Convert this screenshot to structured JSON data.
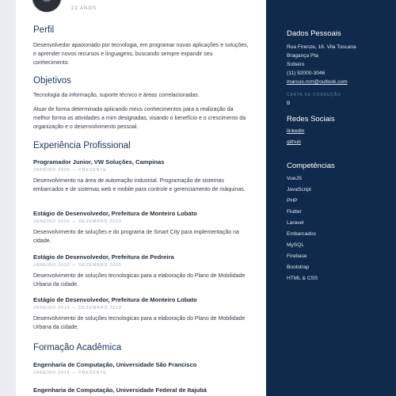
{
  "header": {
    "age": "22 ANOS"
  },
  "perfil": {
    "title": "Perfil",
    "text": "Desenvolvedor apaixonado por tecnologia, em programar novas aplicações e soluções, e aprender novos recursos e linguagens, buscando sempre expandir seu conhecimento."
  },
  "objetivos": {
    "title": "Objetivos",
    "line1": "Tecnologia da informação, suporte técnico e áreas correlacionadas.",
    "text": "Atuar de forma determinada aplicando meus conhecimentos para a realização da melhor forma as atividades a mim designadas, visando o benefício e o crescimento da organização e o desenvolvimento pessoal."
  },
  "experiencia": {
    "title": "Experiência Profissional",
    "jobs": [
      {
        "title": "Programador Junior, VW Soluções, Campinas",
        "date": "JANEIRO 2020 — PRESENTE",
        "desc": "Desenvolvimento na área de automação industrial. Programação de sistemas embarcados e de sistemas web e mobile para controle e gerenciamento de máquinas."
      },
      {
        "title": "Estágio de Desenvolvedor, Prefeitura de Monteiro Lobato",
        "date": "JANEIRO 2020 — DEZEMBRO 2020",
        "desc": "Desenvolvimento de soluções e do programa de Smart City para implementação na cidade."
      },
      {
        "title": "Estágio de Desenvolvedor, Prefeitura de Pedreira",
        "date": "JANEIRO 2020 — DEZEMBRO 2020",
        "desc": "Desenvolvimento de soluções tecnologicas para a elaboração do Plano de Mobilidade Urbana da cidade."
      },
      {
        "title": "Estágio de Desenvolvedor, Prefeitura de Monteiro Lobato",
        "date": "JANEIRO 2019 — DEZEMBRO 2019",
        "desc": "Desenvolvimento de soluções tecnologicas para a elaboração do Plano de Mobilidade Urbana da cidade."
      }
    ]
  },
  "formacao": {
    "title": "Formação Acadêmica",
    "items": [
      {
        "title": "Engenharia de Computação, Universidade São Francisco",
        "date": "JANEIRO 2016 — PRESENTE"
      },
      {
        "title": "Engenharia de Computação, Universidade Federal de Itajubá"
      }
    ]
  },
  "sidebar": {
    "dados_title": "Dados Pessoais",
    "address1": "Rua Firenze, 16. Vila Toscana",
    "address2": "Bragança Pta",
    "status": "Solteiro",
    "phone": "(11) 92000-3046",
    "email": "marcus.rcm@outlook.com",
    "cnh_label": "CARTA DE CONDUÇÃO",
    "cnh_value": "B",
    "redes_title": "Redes Sociais",
    "linkedin": "linkedin",
    "github": "github",
    "competencias_title": "Competências",
    "skills": [
      "VueJS",
      "JavaScript",
      "PHP",
      "Flutter",
      "Laravel",
      "Embarcados",
      "MySQL",
      "Firebase",
      "Bootstrap",
      "HTML & CSS"
    ]
  },
  "colors": {
    "sidebar_bg": "#0f2a4a",
    "heading": "#1d3557",
    "background": "#e9ecf1"
  }
}
